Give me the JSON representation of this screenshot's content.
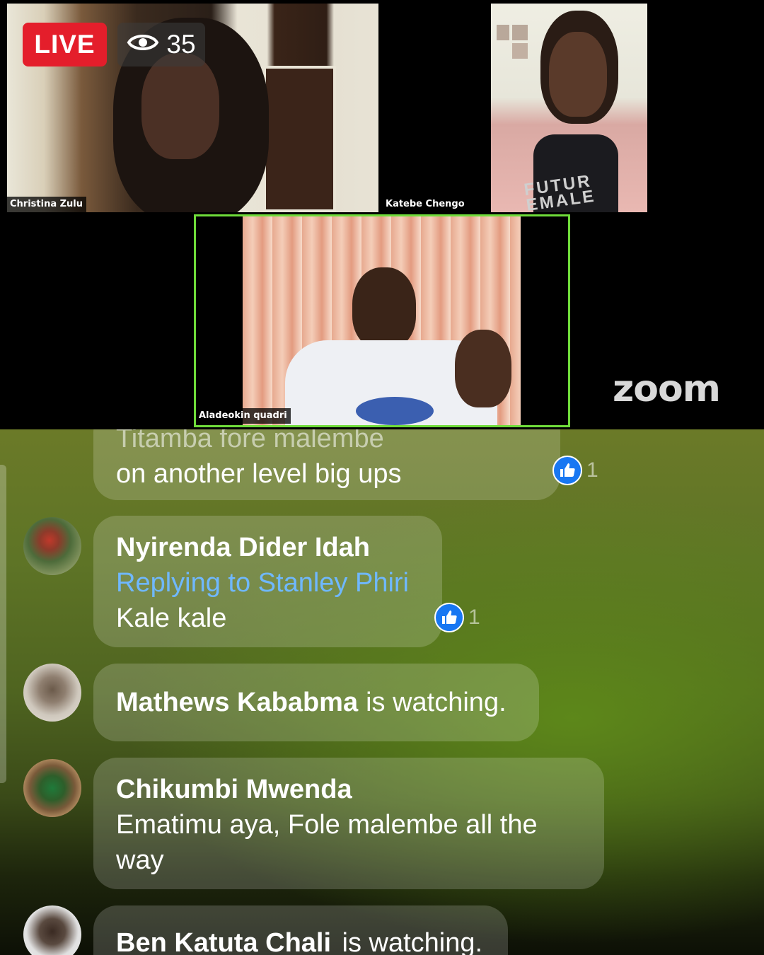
{
  "live": {
    "label": "LIVE",
    "viewer_count": "35",
    "viewer_icon": "eye-icon"
  },
  "participants": [
    {
      "name": "Christina Zulu"
    },
    {
      "name": "Katebe Chengo"
    },
    {
      "name": "Aladeokin quadri"
    }
  ],
  "zoom_logo": "zoom",
  "shirt_text": "FUTUR EMALE",
  "comments": [
    {
      "partial_text": "Titamba fore malembe",
      "text": "on another level big ups",
      "likes": "1"
    },
    {
      "name": "Nyirenda Dider Idah",
      "reply_to": "Replying to Stanley Phiri",
      "text": "Kale kale",
      "likes": "1"
    },
    {
      "name": "Mathews Kababma",
      "status": "is watching."
    },
    {
      "name": "Chikumbi Mwenda",
      "text_line1": "Ematimu aya, Fole malembe all the",
      "text_line2": "way"
    },
    {
      "name": "Ben Katuta Chali",
      "status": "is watching."
    }
  ],
  "colors": {
    "live_red": "#e41e2b",
    "active_speaker_border": "#6fdc3a",
    "like_blue": "#1877f2",
    "reply_blue": "#6fb8ff"
  }
}
